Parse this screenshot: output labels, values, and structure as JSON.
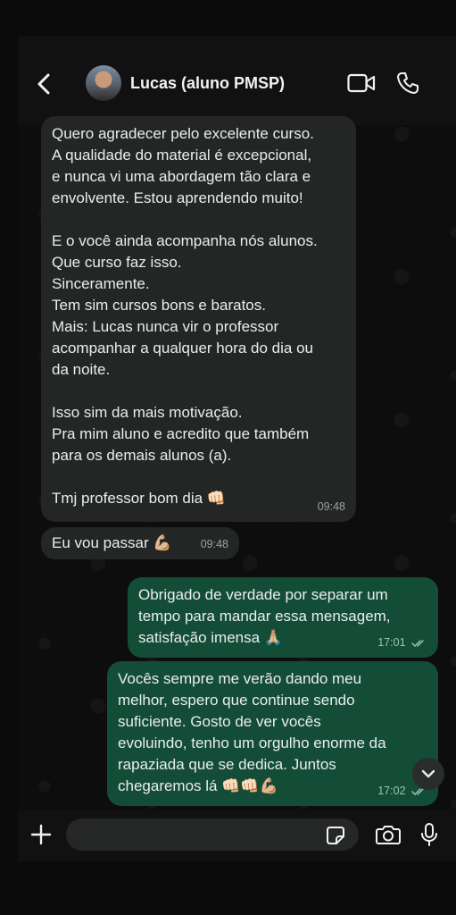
{
  "header": {
    "contact_name": "Lucas (aluno PMSP)",
    "icons": {
      "back": "chevron-left-icon",
      "video": "video-camera-icon",
      "call": "phone-icon"
    }
  },
  "messages": [
    {
      "direction": "incoming",
      "text": "Quero agradecer pelo excelente curso.\nA qualidade do material é excepcional,\ne nunca vi uma abordagem tão clara e\nenvolvente. Estou aprendendo muito!\n\nE o você ainda acompanha nós alunos.\nQue curso faz isso.\nSinceramente.\nTem sim cursos bons e baratos.\nMais: Lucas nunca vir o professor\nacompanhar a qualquer hora do dia ou\nda noite.\n\nIsso sim da mais motivação.\nPra mim aluno e acredito que também\npara os demais alunos (a).\n\nTmj professor bom dia 👊🏻",
      "time": "09:48"
    },
    {
      "direction": "incoming",
      "text": "Eu vou passar 💪🏼",
      "time": "09:48"
    },
    {
      "direction": "outgoing",
      "text": "Obrigado de verdade por separar um\ntempo para mandar essa mensagem,\nsatisfação imensa 🙏🏼",
      "time": "17:01",
      "status": "read"
    },
    {
      "direction": "outgoing",
      "text": "Vocês sempre me verão dando meu\nmelhor, espero que continue sendo\nsuficiente. Gosto de ver vocês\nevoluindo, tenho um orgulho enorme da\nrapaziada que se dedica. Juntos\nchegaremos lá 👊🏻👊🏻💪🏼",
      "time": "17:02",
      "status": "read"
    }
  ],
  "composer": {
    "input_value": "",
    "icons": {
      "attach": "plus-icon",
      "sticker": "sticker-icon",
      "camera": "camera-icon",
      "mic": "microphone-icon"
    }
  },
  "colors": {
    "background": "#0d0d0d",
    "incoming_bubble": "#242626",
    "outgoing_bubble": "#144d37",
    "read_ticks": "#9ec2b2"
  }
}
